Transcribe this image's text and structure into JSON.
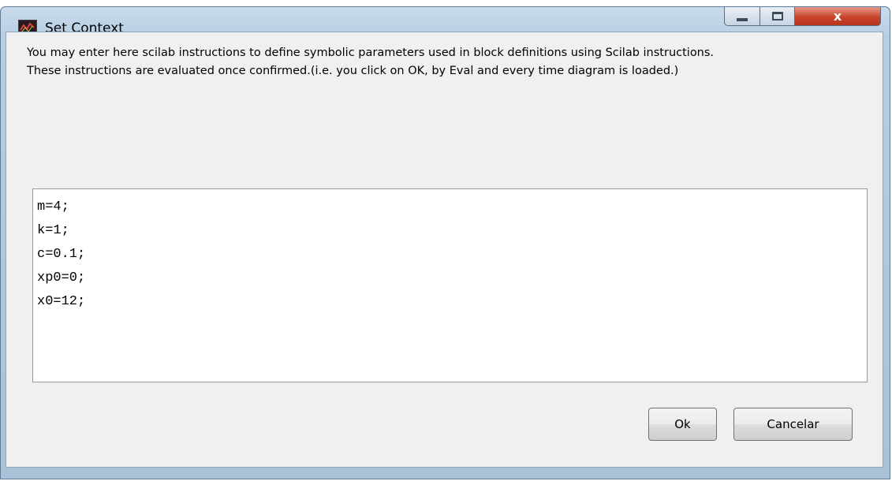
{
  "window": {
    "title": "Set Context",
    "controls": {
      "close_glyph": "x"
    }
  },
  "description": {
    "line1": "You may enter here scilab instructions to define symbolic parameters used in block definitions using Scilab instructions.",
    "line2": "These instructions are evaluated once confirmed.(i.e. you click on OK, by Eval and every time diagram is loaded.)"
  },
  "editor": {
    "lines": [
      "m=4;",
      "k=1;",
      "c=0.1;",
      "xp0=0;",
      "x0=12;"
    ]
  },
  "buttons": {
    "ok_label": "Ok",
    "cancel_label": "Cancelar"
  },
  "icons": {
    "app": "scilab-icon",
    "minimize": "minimize-icon",
    "maximize": "maximize-icon",
    "close": "close-icon"
  },
  "colors": {
    "close_button": "#c8432b",
    "dialog_background": "#f0f0f0",
    "titlebar": "#b6cde2"
  }
}
